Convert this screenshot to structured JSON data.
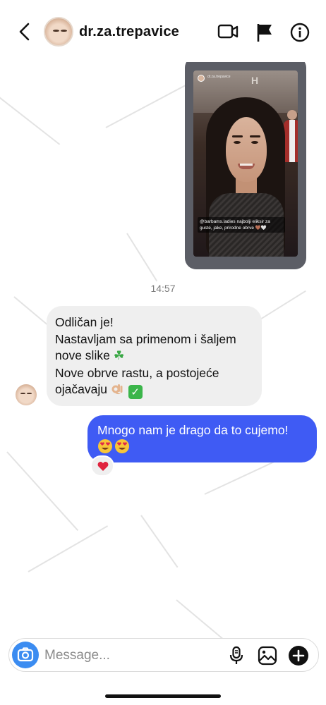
{
  "header": {
    "title": "dr.za.trepavice",
    "back_icon": "chevron-left-icon",
    "video_icon": "video-camera-icon",
    "flag_icon": "flag-icon",
    "info_icon": "info-icon"
  },
  "story": {
    "username": "dr.za.trepavice",
    "caption": "@barbams.ladies najbolji eliksir za guste, jake, prirodne obrve 🤎🤍"
  },
  "conversation": {
    "timestamp": "14:57",
    "incoming": {
      "lines": [
        "Odličan je!",
        "Nastavljam sa primenom i šaljem",
        "nove slike",
        "Nove obrve rastu, a postojeće",
        "ojačavaju"
      ]
    },
    "outgoing": {
      "text": "Mnogo nam je drago da to cujemo!"
    },
    "reaction_icon": "heart-icon"
  },
  "composer": {
    "placeholder": "Message...",
    "camera_icon": "camera-icon",
    "mic_icon": "microphone-icon",
    "gallery_icon": "gallery-icon",
    "plus_icon": "plus-icon"
  },
  "colors": {
    "outgoing_bubble": "#3f5bf4",
    "incoming_bubble": "#efefef",
    "camera_button": "#3b8cf1"
  }
}
